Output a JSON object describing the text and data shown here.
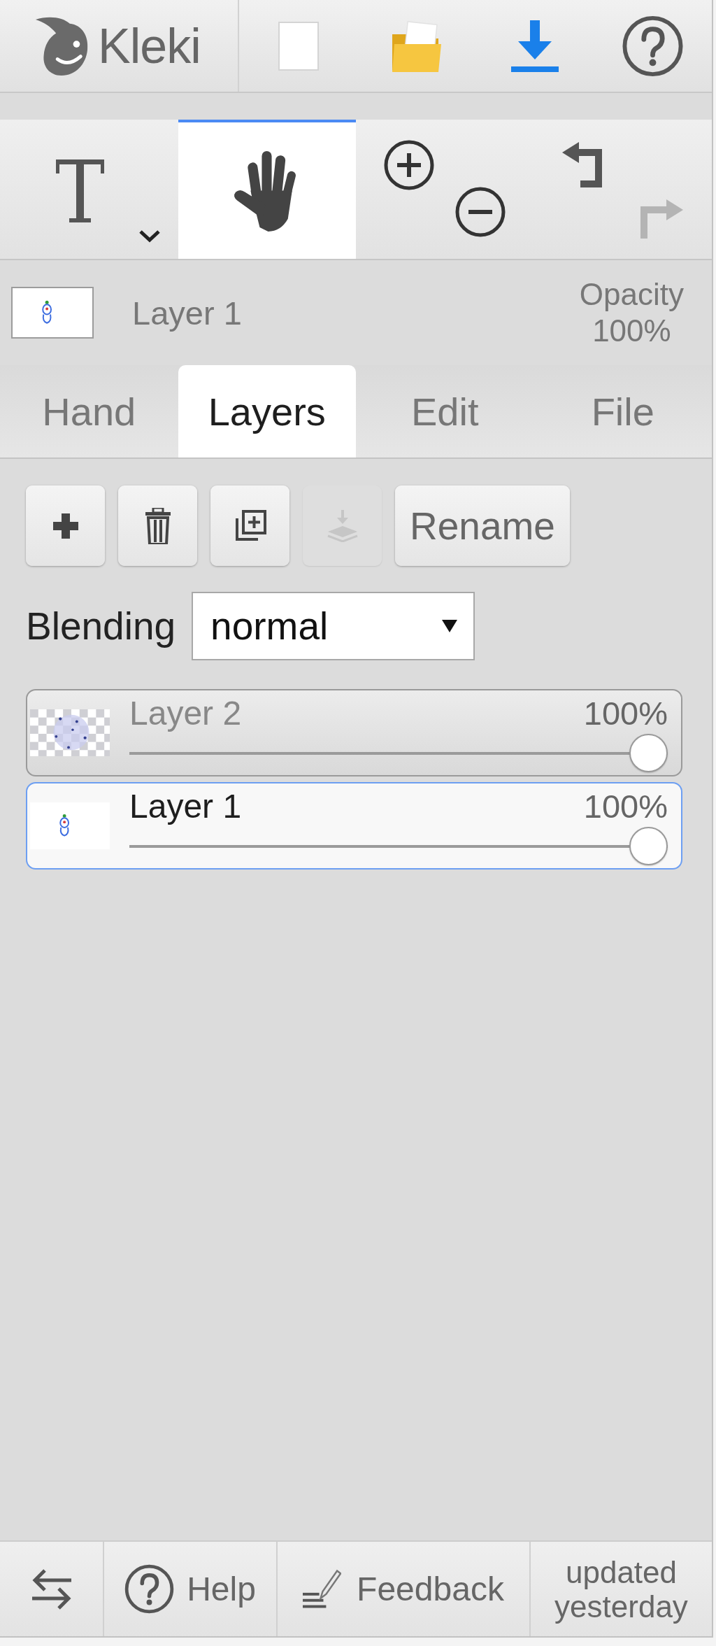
{
  "header": {
    "logo_text": "Kleki"
  },
  "tools": [
    {
      "kind": "text",
      "selected": false
    },
    {
      "kind": "hand",
      "selected": true
    }
  ],
  "history": [
    {
      "kind": "undo",
      "disabled": false
    },
    {
      "kind": "redo",
      "disabled": true
    }
  ],
  "current_layer": {
    "name": "Layer 1",
    "transparent": false,
    "opacity_label": "Opacity",
    "opacity_value": "100%"
  },
  "tabs": [
    {
      "label": "Hand",
      "selected": false
    },
    {
      "label": "Layers",
      "selected": true
    },
    {
      "label": "Edit",
      "selected": false
    },
    {
      "label": "File",
      "selected": false
    }
  ],
  "layer_buttons": [
    {
      "kind": "add",
      "disabled": false
    },
    {
      "kind": "delete",
      "disabled": false
    },
    {
      "kind": "duplicate",
      "disabled": false
    },
    {
      "kind": "merge",
      "disabled": true
    },
    {
      "kind": "rename",
      "label": "Rename",
      "disabled": false
    }
  ],
  "blending": {
    "label": "Blending",
    "value": "normal"
  },
  "layers": [
    {
      "name": "Layer 2",
      "opacity": "100%",
      "level": 1,
      "transparent": true,
      "selected": false
    },
    {
      "name": "Layer 1",
      "opacity": "100%",
      "level": 1,
      "transparent": false,
      "selected": true
    }
  ],
  "footer": [
    {
      "kind": "swap"
    },
    {
      "kind": "help",
      "label": "Help"
    },
    {
      "kind": "feedback",
      "label": "Feedback"
    },
    {
      "kind": "note",
      "label": "updated yesterday"
    }
  ]
}
